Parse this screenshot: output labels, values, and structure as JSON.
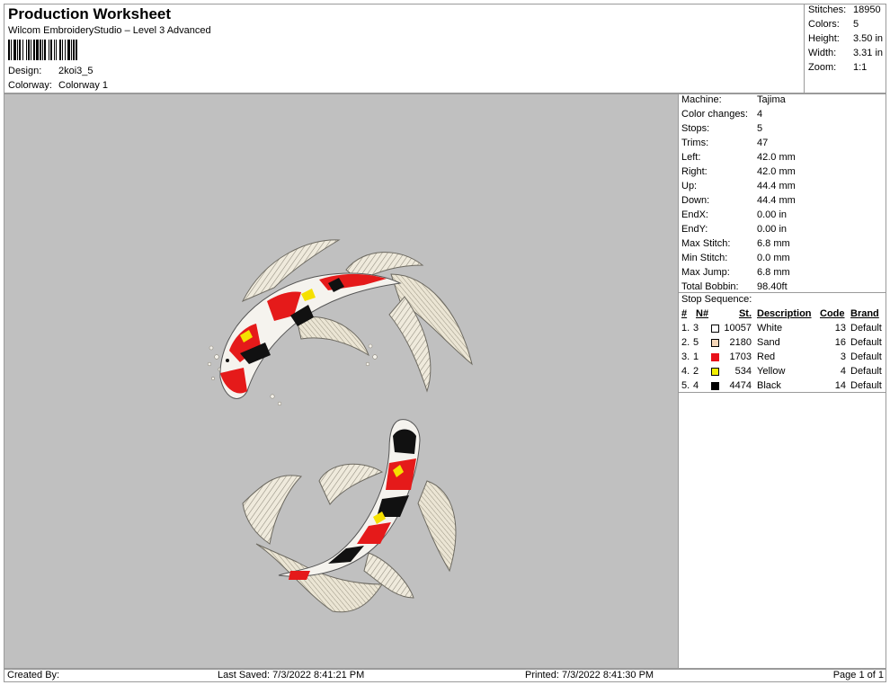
{
  "header": {
    "title": "Production Worksheet",
    "subtitle": "Wilcom EmbroideryStudio – Level 3 Advanced",
    "design_label": "Design:",
    "design_value": "2koi3_5",
    "colorway_label": "Colorway:",
    "colorway_value": "Colorway 1"
  },
  "summary": [
    {
      "label": "Stitches:",
      "value": "18950"
    },
    {
      "label": "Colors:",
      "value": "5"
    },
    {
      "label": "Height:",
      "value": "3.50 in"
    },
    {
      "label": "Width:",
      "value": "3.31 in"
    },
    {
      "label": "Zoom:",
      "value": "1:1"
    }
  ],
  "stats": [
    {
      "label": "Machine:",
      "value": "Tajima"
    },
    {
      "label": "Color changes:",
      "value": "4"
    },
    {
      "label": "Stops:",
      "value": "5"
    },
    {
      "label": "Trims:",
      "value": "47"
    },
    {
      "label": "Left:",
      "value": "42.0 mm"
    },
    {
      "label": "Right:",
      "value": "42.0 mm"
    },
    {
      "label": "Up:",
      "value": "44.4 mm"
    },
    {
      "label": "Down:",
      "value": "44.4 mm"
    },
    {
      "label": "EndX:",
      "value": "0.00 in"
    },
    {
      "label": "EndY:",
      "value": "0.00 in"
    },
    {
      "label": "Max Stitch:",
      "value": "6.8 mm"
    },
    {
      "label": "Min Stitch:",
      "value": "0.0 mm"
    },
    {
      "label": "Max Jump:",
      "value": "6.8 mm"
    },
    {
      "label": "Total Bobbin:",
      "value": "98.40ft"
    }
  ],
  "stops": {
    "title": "Stop Sequence:",
    "headers": {
      "index": "#",
      "needle": "N#",
      "stitches": "St.",
      "description": "Description",
      "code": "Code",
      "brand": "Brand"
    },
    "rows": [
      {
        "index": "1.",
        "needle": "3",
        "color": "#ffffff",
        "stitches": "10057",
        "description": "White",
        "code": "13",
        "brand": "Default"
      },
      {
        "index": "2.",
        "needle": "5",
        "color": "#f5d6b8",
        "stitches": "2180",
        "description": "Sand",
        "code": "16",
        "brand": "Default"
      },
      {
        "index": "3.",
        "needle": "1",
        "color": "#e8101a",
        "stitches": "1703",
        "description": "Red",
        "code": "3",
        "brand": "Default"
      },
      {
        "index": "4.",
        "needle": "2",
        "color": "#f2ee00",
        "stitches": "534",
        "description": "Yellow",
        "code": "4",
        "brand": "Default"
      },
      {
        "index": "5.",
        "needle": "4",
        "color": "#000000",
        "stitches": "4474",
        "description": "Black",
        "code": "14",
        "brand": "Default"
      }
    ]
  },
  "footer": {
    "created_by": "Created By:",
    "last_saved": "Last Saved: 7/3/2022 8:41:21 PM",
    "printed": "Printed: 7/3/2022 8:41:30 PM",
    "page": "Page 1 of 1"
  },
  "colors": {
    "canvas_bg": "#c0c0c0",
    "border": "#9a9a9a"
  },
  "icons": {
    "barcode": "barcode-icon",
    "design_preview": "koi-embroidery-image"
  }
}
